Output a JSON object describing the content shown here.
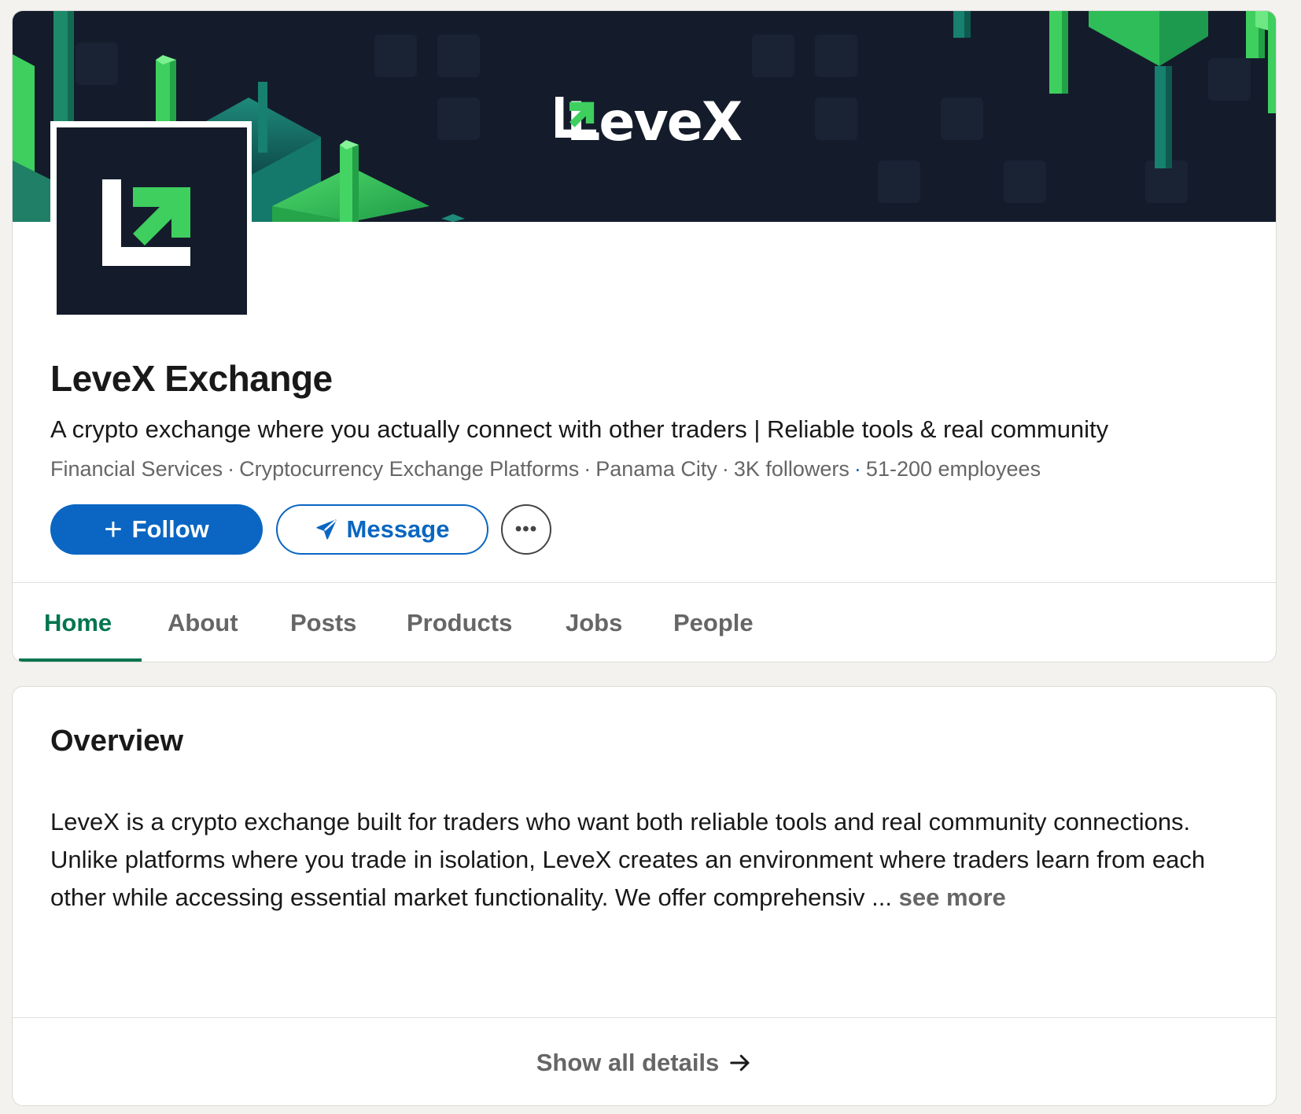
{
  "colors": {
    "primary_blue": "#0a66c2",
    "active_green": "#01754f",
    "brand_dark": "#141c2b",
    "brand_green": "#3ecf5e"
  },
  "banner": {
    "wordmark": "LeveX",
    "logo_icon": "levex-logo-icon"
  },
  "company": {
    "name": "LeveX Exchange",
    "tagline": "A crypto exchange where you actually connect with other traders | Reliable tools & real community",
    "industry": "Financial Services",
    "category": "Cryptocurrency Exchange Platforms",
    "location": "Panama City",
    "followers": "3K followers",
    "employees": "51-200 employees"
  },
  "actions": {
    "follow_label": "Follow",
    "follow_icon": "plus-icon",
    "message_label": "Message",
    "message_icon": "send-icon",
    "more_icon": "ellipsis-icon",
    "more_label": "•••"
  },
  "tabs": [
    {
      "label": "Home",
      "active": true
    },
    {
      "label": "About",
      "active": false
    },
    {
      "label": "Posts",
      "active": false
    },
    {
      "label": "Products",
      "active": false
    },
    {
      "label": "Jobs",
      "active": false
    },
    {
      "label": "People",
      "active": false
    }
  ],
  "overview": {
    "title": "Overview",
    "text": "LeveX is a crypto exchange built for traders who want both reliable tools and real community connections. Unlike platforms where you trade in isolation, LeveX creates an environment where traders learn from each other while accessing essential market functionality. We offer comprehensiv ...",
    "see_more": "see more",
    "show_all_label": "Show all details",
    "show_all_icon": "arrow-right-icon"
  }
}
